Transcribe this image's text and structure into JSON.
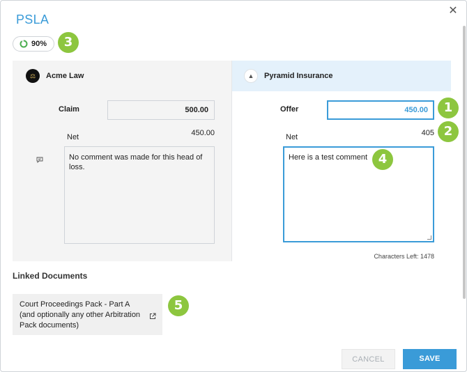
{
  "dialog": {
    "title": "PSLA",
    "close_glyph": "✕"
  },
  "progress": {
    "label": "90%",
    "value": 0.9
  },
  "left_party": {
    "name": "Acme Law",
    "logo_icon": "scales-of-justice-icon",
    "claim_label": "Claim",
    "claim_value": "500.00",
    "net_label": "Net",
    "net_value": "450.00",
    "comment": "No comment was made for this head of loss."
  },
  "right_party": {
    "name": "Pyramid Insurance",
    "logo_icon": "pyramid-icon",
    "offer_label": "Offer",
    "offer_value": "450.00",
    "net_label": "Net",
    "net_value": "405",
    "comment": "Here is a test comment",
    "chars_left": "Characters Left: 1478"
  },
  "linked_documents": {
    "title": "Linked Documents",
    "items": [
      {
        "label": "Court Proceedings Pack - Part A (and optionally any other Arbitration Pack documents)"
      }
    ]
  },
  "footer": {
    "cancel_label": "CANCEL",
    "save_label": "SAVE"
  },
  "callouts": [
    "1",
    "2",
    "3",
    "4",
    "5"
  ],
  "colors": {
    "accent": "#3a9bd8",
    "callout": "#8dc63f",
    "panel": "#f4f4f4",
    "panel_highlight": "#e4f1fb"
  }
}
